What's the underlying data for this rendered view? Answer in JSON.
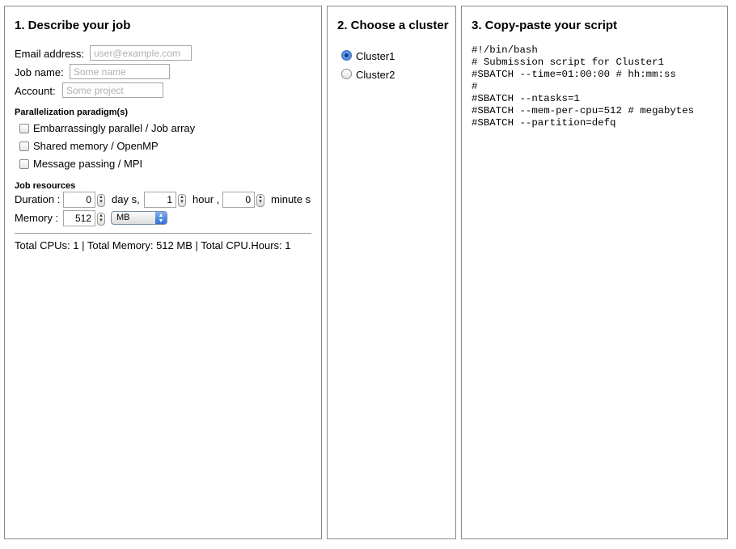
{
  "panel1": {
    "title": "1. Describe your job",
    "email": {
      "label": "Email address:",
      "placeholder": "user@example.com"
    },
    "job_name": {
      "label": "Job name:",
      "placeholder": "Some name"
    },
    "account": {
      "label": "Account:",
      "placeholder": "Some project"
    },
    "parallel_heading": "Parallelization paradigm(s)",
    "paradigms": [
      "Embarrassingly parallel / Job array",
      "Shared memory / OpenMP",
      "Message passing / MPI"
    ],
    "resources_heading": "Job resources",
    "duration": {
      "label": "Duration :",
      "days": "0",
      "days_unit": "day s,",
      "hours": "1",
      "hours_unit": "hour ,",
      "minutes": "0",
      "minutes_unit": "minute s"
    },
    "memory": {
      "label": "Memory :",
      "value": "512",
      "unit": "MB"
    },
    "summary": "Total CPUs: 1 | Total Memory: 512 MB | Total CPU.Hours: 1"
  },
  "panel2": {
    "title": "2. Choose a cluster",
    "clusters": [
      {
        "label": "Cluster1",
        "selected": true
      },
      {
        "label": "Cluster2",
        "selected": false
      }
    ]
  },
  "panel3": {
    "title": "3. Copy-paste your script",
    "script": "#!/bin/bash\n# Submission script for Cluster1\n#SBATCH --time=01:00:00 # hh:mm:ss\n#\n#SBATCH --ntasks=1\n#SBATCH --mem-per-cpu=512 # megabytes\n#SBATCH --partition=defq"
  }
}
